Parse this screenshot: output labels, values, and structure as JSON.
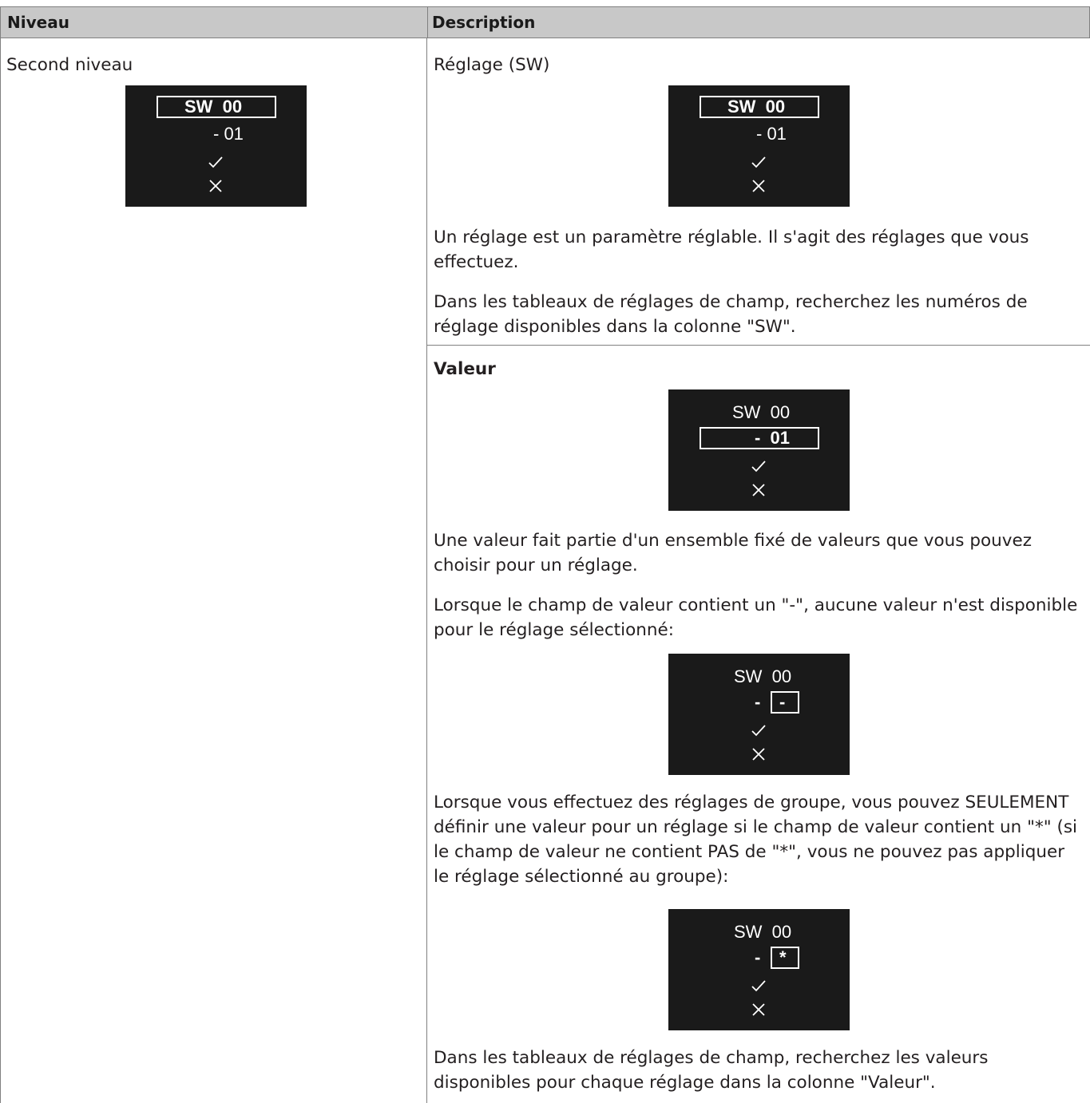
{
  "table": {
    "headers": [
      "Niveau",
      "Description"
    ],
    "left_cell": {
      "label": "Second niveau",
      "display": {
        "line1": "SW  00",
        "line2": "- 01"
      }
    },
    "right_cells": [
      {
        "heading": "Réglage (SW)",
        "display": {
          "line1": "SW  00",
          "line2": "- 01"
        },
        "paragraphs": [
          "Un réglage est un paramètre réglable. Il s'agit des réglages que vous effectuez.",
          "Dans les tableaux de réglages de champ, recherchez les numéros de réglage disponibles dans la colonne \"SW\"."
        ]
      },
      {
        "heading": "Valeur",
        "display1": {
          "line1": "SW  00",
          "line2": "-  01"
        },
        "para1": "Une valeur fait partie d'un ensemble fixé de valeurs que vous pouvez choisir pour un réglage.",
        "para2": "Lorsque le champ de valeur contient un \"-\", aucune valeur n'est disponible pour le réglage sélectionné:",
        "display2": {
          "line1": "SW  00",
          "dash": "-",
          "boxed": "-"
        },
        "para3": "Lorsque vous effectuez des réglages de groupe, vous pouvez SEULEMENT définir une valeur pour un réglage si le champ de valeur contient un \"*\" (si le champ de valeur ne contient PAS de \"*\", vous ne pouvez pas appliquer le réglage sélectionné au groupe):",
        "display3": {
          "line1": "SW  00",
          "dash": "-",
          "boxed": "*"
        },
        "para4": "Dans les tableaux de réglages de champ, recherchez les valeurs disponibles pour chaque réglage dans la colonne \"Valeur\"."
      }
    ]
  }
}
